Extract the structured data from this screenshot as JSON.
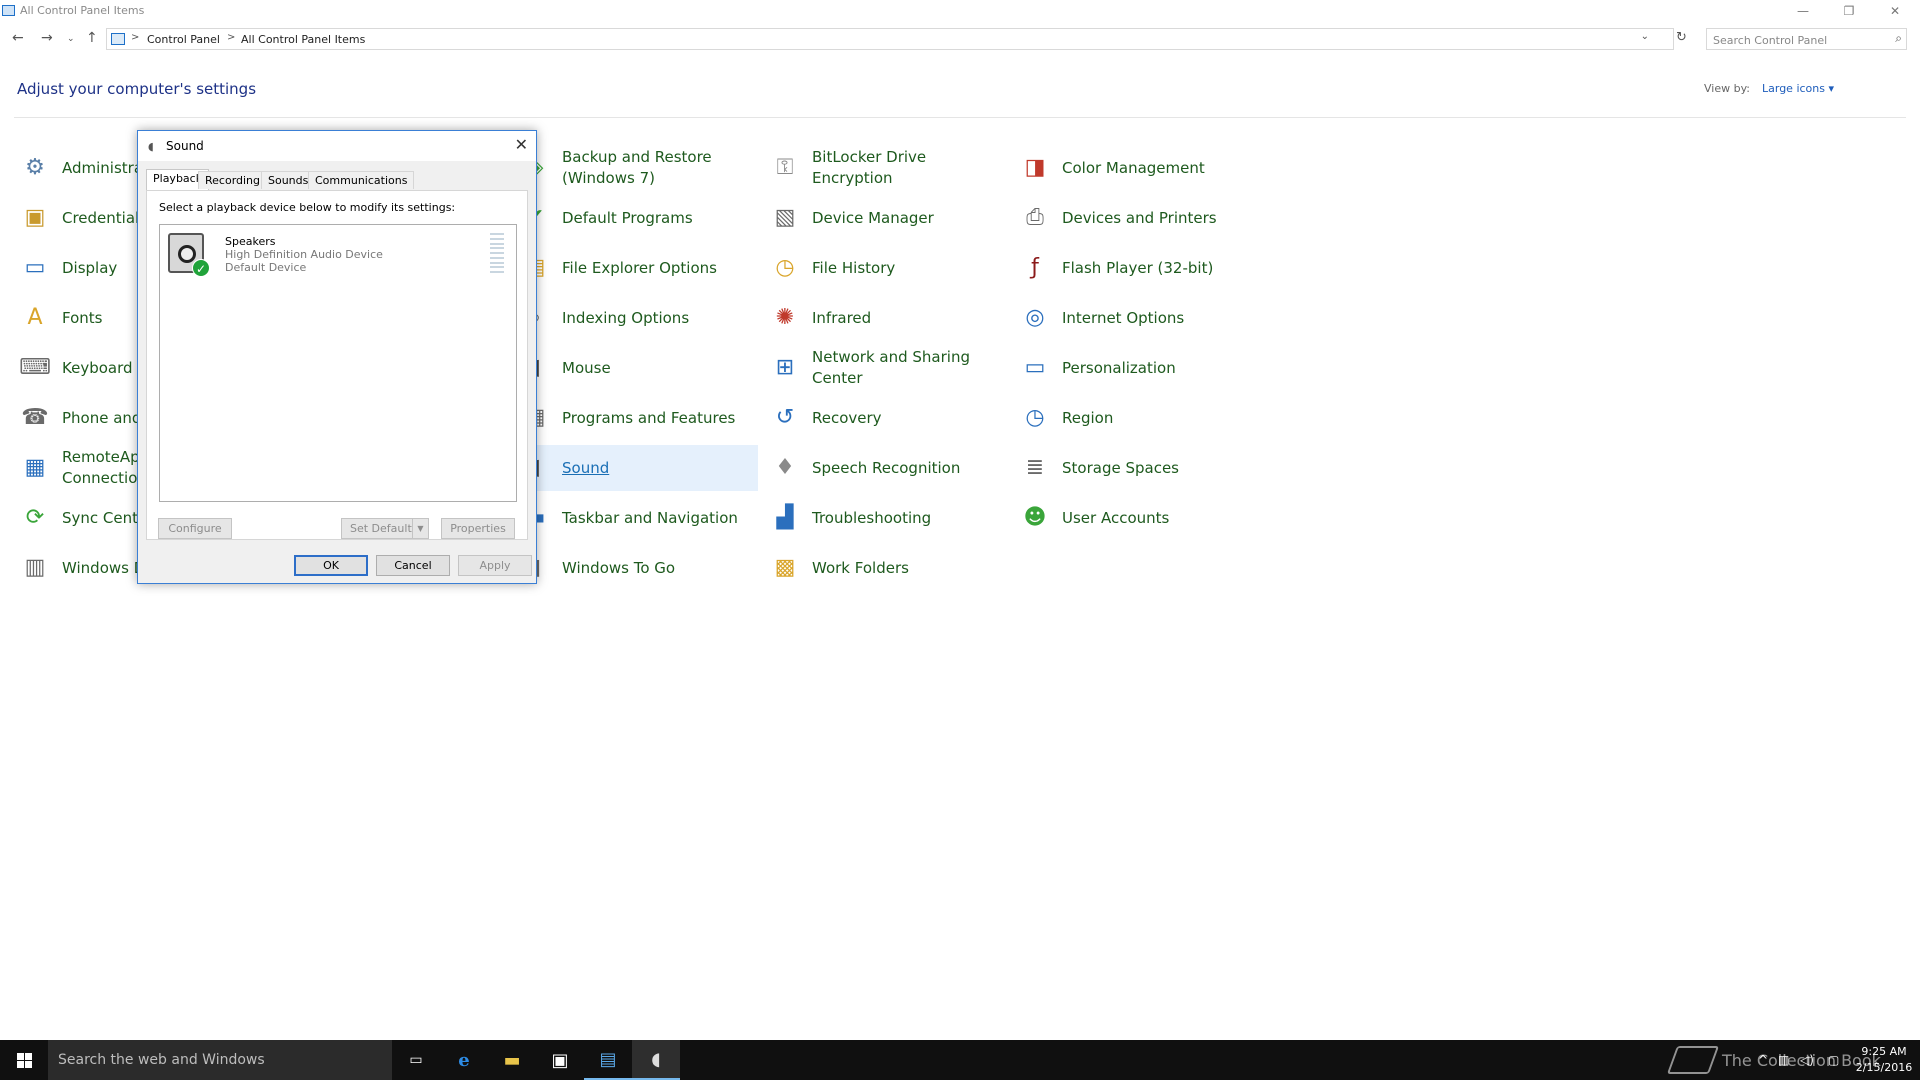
{
  "window": {
    "title": "All Control Panel Items",
    "minimize_glyph": "—",
    "restore_glyph": "❐",
    "close_glyph": "✕"
  },
  "address": {
    "crumbs": [
      "Control Panel",
      "All Control Panel Items"
    ],
    "separator": ">",
    "search_placeholder": "Search Control Panel"
  },
  "header": {
    "title": "Adjust your computer's settings",
    "view_by_label": "View by:",
    "view_by_value": "Large icons ▾"
  },
  "items": [
    {
      "label": "Administrative Tools",
      "icon": "admin-tools-icon",
      "color": "#5a7fa8"
    },
    {
      "label": "Credential Manager",
      "icon": "credential-manager-icon",
      "color": "#c99a2e"
    },
    {
      "label": "Display",
      "icon": "display-icon",
      "color": "#2b6fbd"
    },
    {
      "label": "Fonts",
      "icon": "fonts-icon",
      "color": "#d9a52b"
    },
    {
      "label": "Keyboard",
      "icon": "keyboard-icon",
      "color": "#6a6a6a"
    },
    {
      "label": "Phone and Modem",
      "icon": "phone-modem-icon",
      "color": "#6a6a6a"
    },
    {
      "label": "RemoteApp and Desktop Connections",
      "icon": "remoteapp-icon",
      "color": "#2b6fbd"
    },
    {
      "label": "Sync Center",
      "icon": "sync-center-icon",
      "color": "#3aa53a"
    },
    {
      "label": "Windows Defender",
      "icon": "windows-defender-icon",
      "color": "#6a6a6a"
    },
    {
      "label": "Backup and Restore (Windows 7)",
      "icon": "backup-restore-icon",
      "color": "#3aa53a"
    },
    {
      "label": "Default Programs",
      "icon": "default-programs-icon",
      "color": "#3aa53a"
    },
    {
      "label": "File Explorer Options",
      "icon": "file-explorer-options-icon",
      "color": "#d9a52b"
    },
    {
      "label": "Indexing Options",
      "icon": "indexing-options-icon",
      "color": "#6a6a6a"
    },
    {
      "label": "Mouse",
      "icon": "mouse-icon",
      "color": "#444444"
    },
    {
      "label": "Programs and Features",
      "icon": "programs-features-icon",
      "color": "#6a6a6a"
    },
    {
      "label": "Sound",
      "icon": "sound-icon",
      "color": "#444444"
    },
    {
      "label": "Taskbar and Navigation",
      "icon": "taskbar-navigation-icon",
      "color": "#2b6fbd"
    },
    {
      "label": "Windows To Go",
      "icon": "windows-to-go-icon",
      "color": "#6a6a6a"
    },
    {
      "label": "BitLocker Drive Encryption",
      "icon": "bitlocker-icon",
      "color": "#8a8a8a"
    },
    {
      "label": "Device Manager",
      "icon": "device-manager-icon",
      "color": "#6a6a6a"
    },
    {
      "label": "File History",
      "icon": "file-history-icon",
      "color": "#d9a52b"
    },
    {
      "label": "Infrared",
      "icon": "infrared-icon",
      "color": "#c0392b"
    },
    {
      "label": "Network and Sharing Center",
      "icon": "network-sharing-icon",
      "color": "#2b6fbd"
    },
    {
      "label": "Recovery",
      "icon": "recovery-icon",
      "color": "#2b6fbd"
    },
    {
      "label": "Speech Recognition",
      "icon": "speech-recognition-icon",
      "color": "#8a8a8a"
    },
    {
      "label": "Troubleshooting",
      "icon": "troubleshooting-icon",
      "color": "#2b6fbd"
    },
    {
      "label": "Work Folders",
      "icon": "work-folders-icon",
      "color": "#d9a52b"
    },
    {
      "label": "Color Management",
      "icon": "color-management-icon",
      "color": "#c0392b"
    },
    {
      "label": "Devices and Printers",
      "icon": "devices-printers-icon",
      "color": "#6a6a6a"
    },
    {
      "label": "Flash Player (32-bit)",
      "icon": "flash-player-icon",
      "color": "#8b1a1a"
    },
    {
      "label": "Internet Options",
      "icon": "internet-options-icon",
      "color": "#2b6fbd"
    },
    {
      "label": "Personalization",
      "icon": "personalization-icon",
      "color": "#2b6fbd"
    },
    {
      "label": "Region",
      "icon": "region-icon",
      "color": "#2b6fbd"
    },
    {
      "label": "Storage Spaces",
      "icon": "storage-spaces-icon",
      "color": "#6a6a6a"
    },
    {
      "label": "User Accounts",
      "icon": "user-accounts-icon",
      "color": "#3aa53a"
    }
  ],
  "dialog": {
    "title": "Sound",
    "close_glyph": "✕",
    "tabs": [
      "Playback",
      "Recording",
      "Sounds",
      "Communications"
    ],
    "instructions": "Select a playback device below to modify its settings:",
    "device": {
      "name": "Speakers",
      "description": "High Definition Audio Device",
      "status": "Default Device"
    },
    "buttons": {
      "configure": "Configure",
      "set_default": "Set Default",
      "properties": "Properties",
      "ok": "OK",
      "cancel": "Cancel",
      "apply": "Apply"
    }
  },
  "taskbar": {
    "search_placeholder": "Search the web and Windows",
    "clock_time": "9:25 AM",
    "clock_date": "2/15/2016",
    "watermark": "The Collection Book"
  }
}
